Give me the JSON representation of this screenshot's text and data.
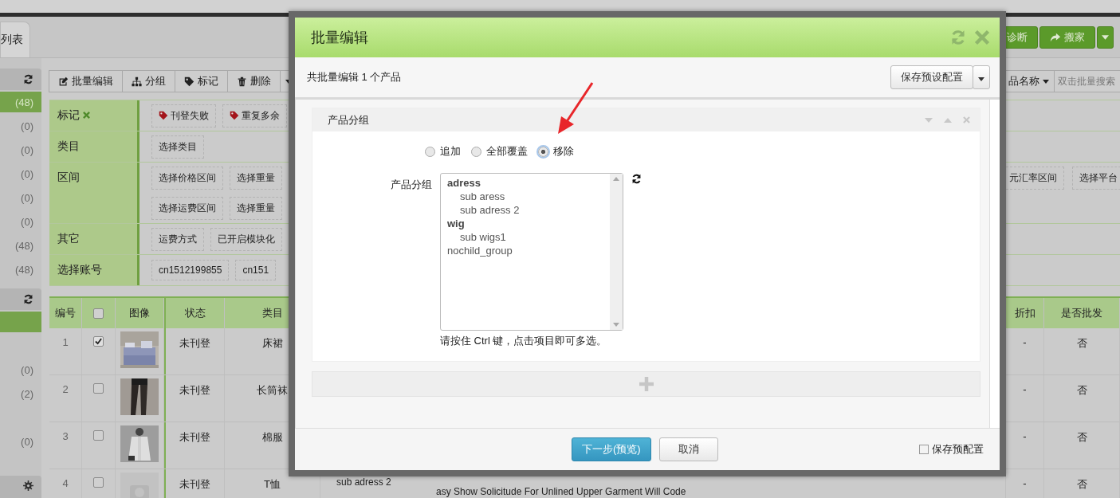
{
  "top_tab": {
    "label": "列表"
  },
  "top_buttons": [
    {
      "kind": "diagnose",
      "label": "诊断"
    },
    {
      "kind": "move",
      "label": "搬家"
    }
  ],
  "sidebar": {
    "groups": [
      {
        "items": [
          {
            "count": "(48)",
            "selected": true
          },
          {
            "count": "(0)",
            "selected": false
          },
          {
            "count": "(0)",
            "selected": false
          },
          {
            "count": "(0)",
            "selected": false
          },
          {
            "count": "(0)",
            "selected": false
          },
          {
            "count": "(0)",
            "selected": false
          },
          {
            "count": "(48)",
            "selected": false
          },
          {
            "count": "(48)",
            "selected": false
          }
        ]
      },
      {
        "items": [
          {
            "selected": true
          },
          {
            "selected": false
          },
          {
            "count": "(0)",
            "selected": false
          },
          {
            "count": "(2)",
            "selected": false
          },
          {
            "selected": false
          },
          {
            "count": "(0)",
            "selected": false
          }
        ]
      }
    ]
  },
  "toolbar": [
    {
      "kind": "edit",
      "label": "批量编辑"
    },
    {
      "kind": "group",
      "label": "分组"
    },
    {
      "kind": "tag",
      "label": "标记"
    },
    {
      "kind": "delete",
      "label": "删除"
    }
  ],
  "search": {
    "field_menu": "品名称",
    "placeholder": "双击批量搜索"
  },
  "filters": [
    {
      "label": "标记",
      "removable": true,
      "lines": [
        [
          {
            "kind": "tag",
            "text": "刊登失败"
          },
          {
            "kind": "tag",
            "text": "重复多余"
          }
        ]
      ]
    },
    {
      "label": "类目",
      "removable": false,
      "lines": [
        [
          {
            "kind": "plain",
            "text": "选择类目"
          }
        ]
      ]
    },
    {
      "label": "区间",
      "removable": false,
      "lines": [
        [
          {
            "kind": "plain",
            "text": "选择价格区间"
          },
          {
            "kind": "plain",
            "text": "选择重量"
          }
        ],
        [
          {
            "kind": "plain",
            "text": "选择运费区间"
          },
          {
            "kind": "plain",
            "text": "选择重量"
          }
        ]
      ],
      "right_chips": [
        {
          "text": "元汇率区间"
        },
        {
          "text": "选择平台"
        }
      ]
    },
    {
      "label": "其它",
      "removable": false,
      "lines": [
        [
          {
            "kind": "plain",
            "text": "运费方式"
          },
          {
            "kind": "plain",
            "text": "已开启模块化"
          }
        ]
      ]
    },
    {
      "label": "选择账号",
      "removable": false,
      "lines": [
        [
          {
            "kind": "plain",
            "text": "cn1512199855"
          },
          {
            "kind": "plain",
            "text": "cn151"
          }
        ]
      ]
    }
  ],
  "table": {
    "columns": [
      "编号",
      "图像",
      "状态",
      "类目",
      "折扣",
      "是否批发"
    ],
    "all_checked": false,
    "rows": [
      {
        "no": "1",
        "checked": true,
        "status": "未刊登",
        "category": "床裙",
        "discount": "-",
        "wholesale": "否"
      },
      {
        "no": "2",
        "checked": false,
        "status": "未刊登",
        "category": "长筒袜",
        "discount": "-",
        "wholesale": "否"
      },
      {
        "no": "3",
        "checked": false,
        "status": "未刊登",
        "category": "棉服",
        "discount": "-",
        "wholesale": "否"
      },
      {
        "no": "4",
        "checked": false,
        "image": {
          "kind": "placeholder"
        },
        "status": "未刊登",
        "category": "T恤",
        "group": "sub adress 2",
        "title": "asy Show Solicitude For Unlined Upper Garment Will Code",
        "discount": "-",
        "wholesale": "否"
      }
    ]
  },
  "modal": {
    "title": "批量编辑",
    "summary": "共批量编辑 1 个产品",
    "preset_button": "保存预设配置",
    "panel": {
      "title": "产品分组",
      "modes": [
        {
          "label": "追加",
          "selected": false
        },
        {
          "label": "全部覆盖",
          "selected": false
        },
        {
          "label": "移除",
          "selected": true
        }
      ],
      "field_label": "产品分组",
      "options": [
        {
          "label": "adress",
          "children": [
            {
              "label": "sub aress"
            },
            {
              "label": "sub adress 2"
            }
          ]
        },
        {
          "label": "wig",
          "children": [
            {
              "label": "sub wigs1"
            }
          ]
        },
        {
          "label": "nochild_group"
        }
      ],
      "hint": "请按住 Ctrl 键，点击项目即可多选。"
    },
    "next_button": "下一步(预览)",
    "cancel_button": "取消",
    "save_preset": {
      "label": "保存预配置",
      "checked": false
    }
  }
}
